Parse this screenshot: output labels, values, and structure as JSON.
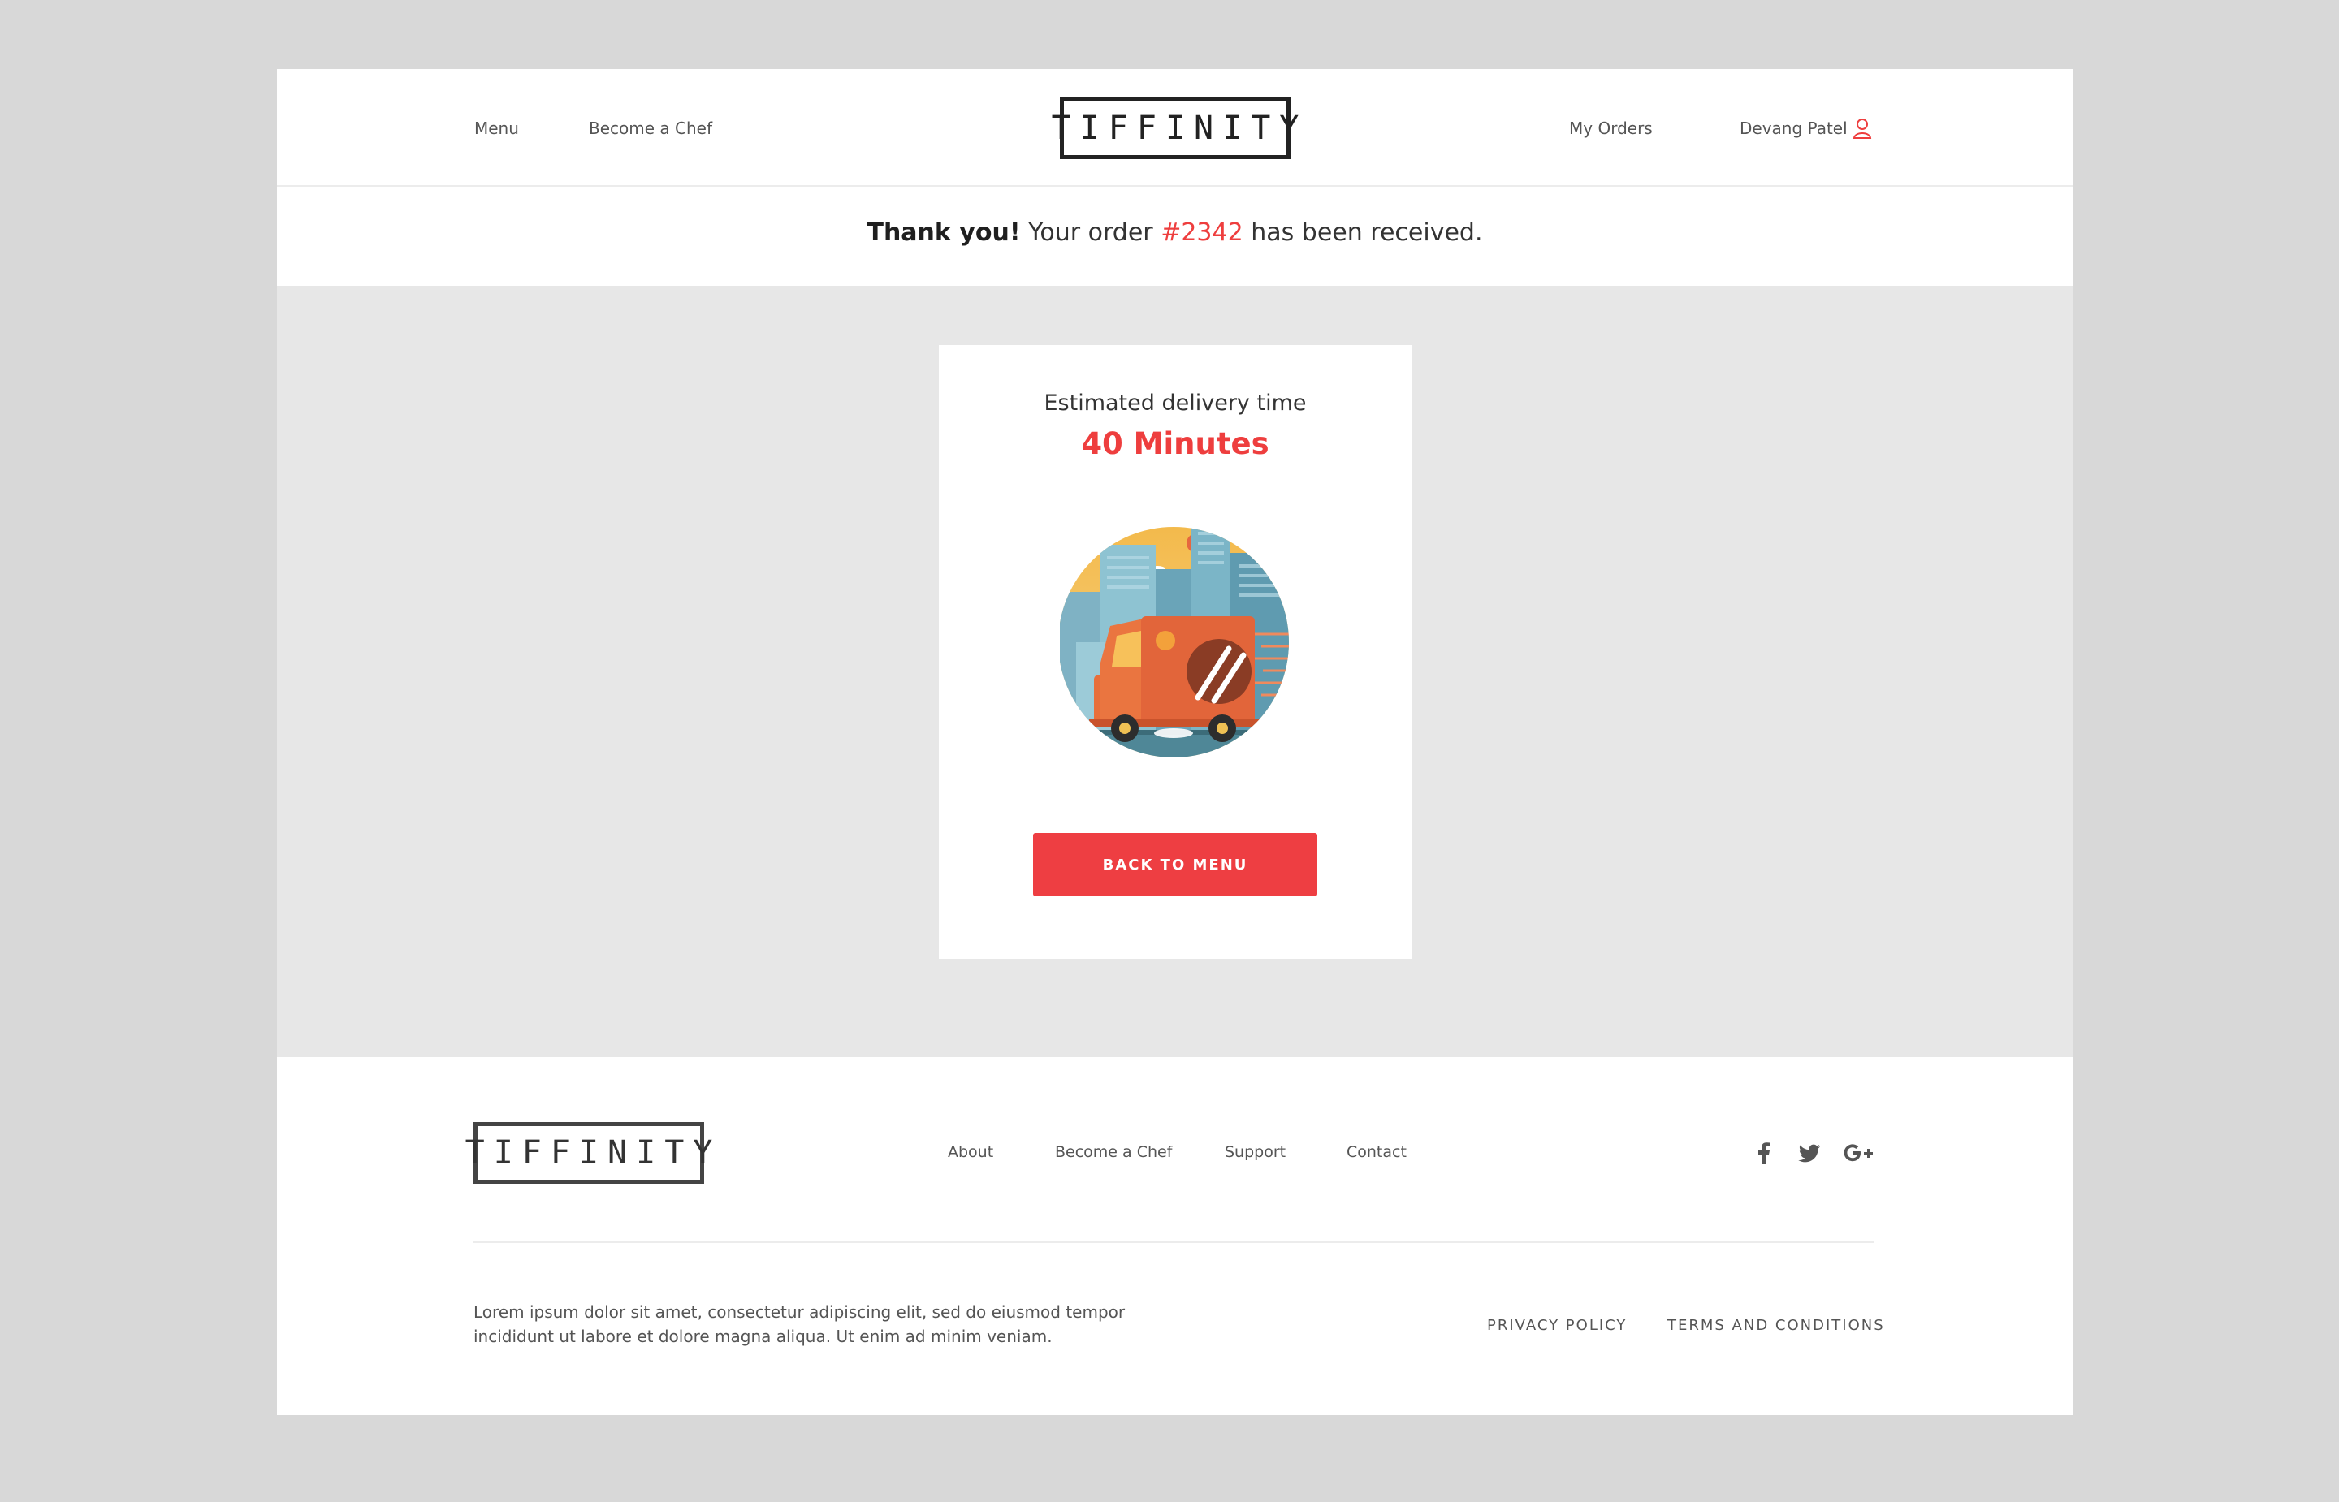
{
  "header": {
    "nav_left": [
      "Menu",
      "Become a Chef"
    ],
    "logo_text": "TIFFINITY",
    "my_orders": "My Orders",
    "user_name": "Devang Patel",
    "user_icon": "user-icon"
  },
  "confirmation": {
    "thanks": "Thank you!",
    "before_order": "Your order",
    "order_number": "#2342",
    "after_order": "has been received."
  },
  "delivery_card": {
    "label": "Estimated delivery time",
    "time": "40 Minutes",
    "illustration": "delivery-truck-city-illustration",
    "button_label": "BACK TO MENU"
  },
  "footer": {
    "logo_text": "TIFFINITY",
    "links": [
      "About",
      "Become a Chef",
      "Support",
      "Contact"
    ],
    "social_icons": [
      "facebook-icon",
      "twitter-icon",
      "google-plus-icon"
    ],
    "description": "Lorem ipsum dolor sit amet, consectetur adipiscing elit, sed do eiusmod tempor incididunt ut labore et dolore magna aliqua. Ut enim ad minim veniam.",
    "legal_links": [
      "PRIVACY POLICY",
      "TERMS AND CONDITIONS"
    ]
  },
  "colors": {
    "accent": "#ee3e3e",
    "page_bg": "#d8d8d8",
    "content_bg": "#e7e7e7",
    "text": "#333333"
  }
}
